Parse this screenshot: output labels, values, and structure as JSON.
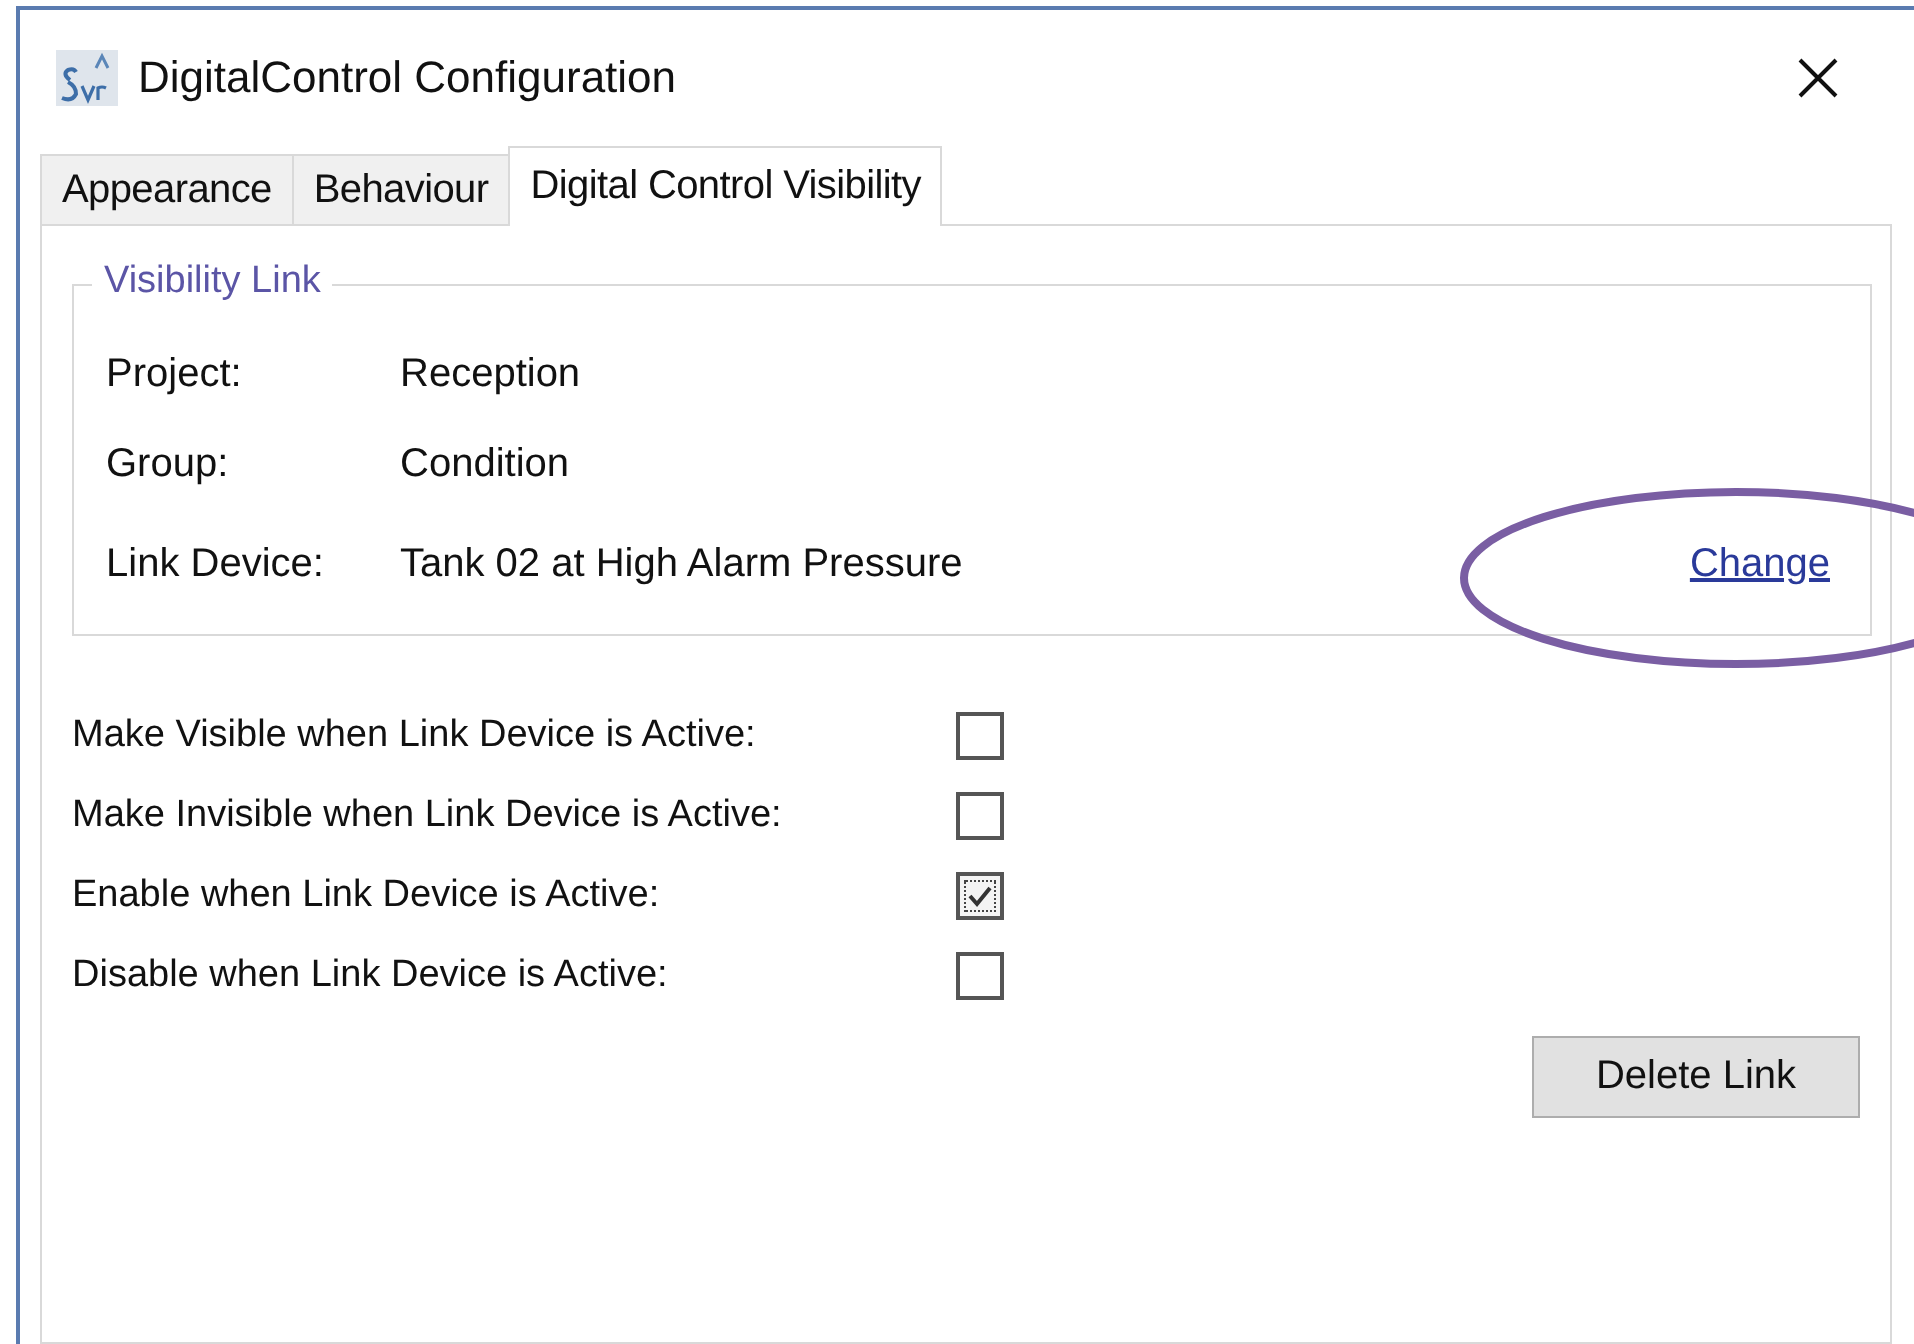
{
  "window": {
    "title": "DigitalControl Configuration"
  },
  "tabs": [
    {
      "label": "Appearance",
      "selected": false
    },
    {
      "label": "Behaviour",
      "selected": false
    },
    {
      "label": "Digital Control Visibility",
      "selected": true
    }
  ],
  "visibility_link": {
    "title": "Visibility Link",
    "fields": [
      {
        "label": "Project:",
        "value": "Reception"
      },
      {
        "label": "Group:",
        "value": "Condition"
      },
      {
        "label": "Link Device:",
        "value": "Tank 02 at High Alarm Pressure"
      }
    ],
    "link": "Change"
  },
  "options": [
    {
      "label": "Make Visible when Link Device is Active:",
      "checked": false
    },
    {
      "label": "Make Invisible when Link Device is Active:",
      "checked": false
    },
    {
      "label": "Enable when Link Device is Active:",
      "checked": true
    },
    {
      "label": "Disable when Link Device is Active:",
      "checked": false
    }
  ],
  "buttons": [
    "Delete Link"
  ],
  "annotation": {
    "kind": "ellipse"
  }
}
